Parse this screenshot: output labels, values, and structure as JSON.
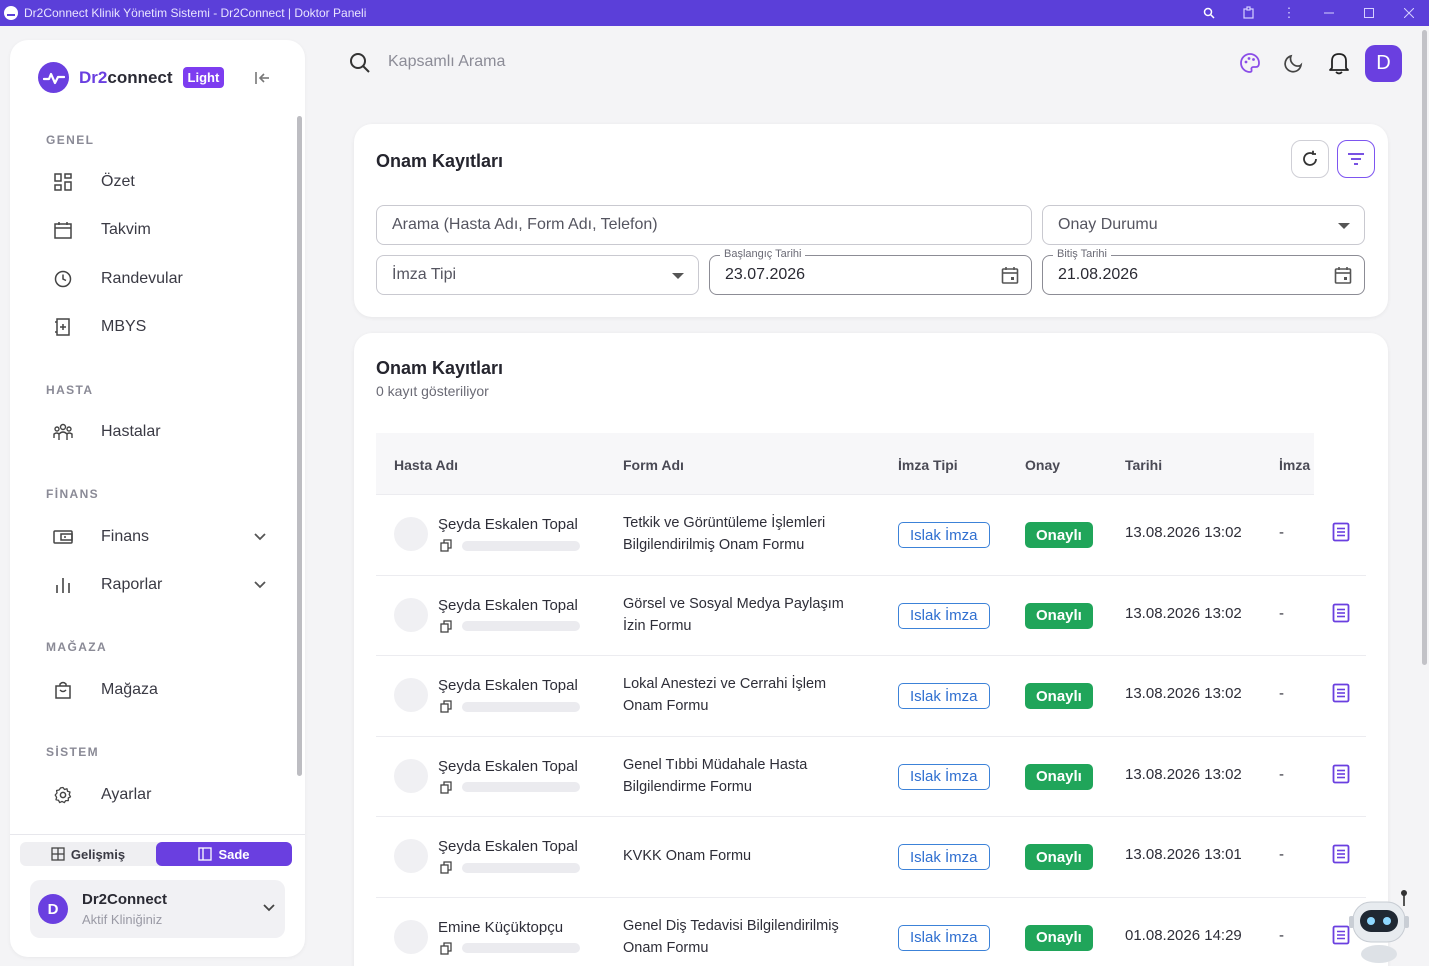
{
  "window": {
    "title": "Dr2Connect Klinik Yönetim Sistemi - Dr2Connect | Doktor Paneli"
  },
  "brand": {
    "name_a": "Dr2",
    "name_b": "connect",
    "badge": "Light"
  },
  "sidebar": {
    "sections": {
      "genel": "GENEL",
      "hasta": "HASTA",
      "finans": "FİNANS",
      "magaza": "MAĞAZA",
      "sistem": "SİSTEM"
    },
    "items": [
      {
        "label": "Özet",
        "icon": "dashboard-icon"
      },
      {
        "label": "Takvim",
        "icon": "calendar-icon"
      },
      {
        "label": "Randevular",
        "icon": "clock-icon"
      },
      {
        "label": "MBYS",
        "icon": "medical-book-icon"
      },
      {
        "label": "Hastalar",
        "icon": "patients-icon"
      },
      {
        "label": "Finans",
        "icon": "wallet-icon"
      },
      {
        "label": "Raporlar",
        "icon": "bar-chart-icon"
      },
      {
        "label": "Mağaza",
        "icon": "shopping-bag-icon"
      },
      {
        "label": "Ayarlar",
        "icon": "gear-icon"
      }
    ],
    "mode": {
      "advanced": "Gelişmiş",
      "simple": "Sade",
      "active": "simple"
    },
    "clinic": {
      "avatar": "D",
      "name": "Dr2Connect",
      "subtitle": "Aktif Kliniğiniz"
    }
  },
  "topbar": {
    "search_placeholder": "Kapsamlı Arama",
    "avatar": "D"
  },
  "filter_card": {
    "title": "Onam Kayıtları",
    "search_placeholder": "Arama (Hasta Adı, Form Adı, Telefon)",
    "approval_select": "Onay Durumu",
    "signature_select": "İmza Tipi",
    "start_label": "Başlangıç Tarihi",
    "start_value": "23.07.2026",
    "end_label": "Bitiş Tarihi",
    "end_value": "21.08.2026"
  },
  "list_card": {
    "title": "Onam Kayıtları",
    "subtitle": "0 kayıt gösteriliyor",
    "columns": [
      "Hasta Adı",
      "Form Adı",
      "İmza Tipi",
      "Onay",
      "Tarihi",
      "İmza"
    ],
    "rows": [
      {
        "patient": "Şeyda Eskalen Topal",
        "form_line1": "Tetkik ve Görüntüleme İşlemleri",
        "form_line2": "Bilgilendirilmiş Onam Formu",
        "signature": "Islak İmza",
        "approval": "Onaylı",
        "date": "13.08.2026 13:02",
        "sign": "-"
      },
      {
        "patient": "Şeyda Eskalen Topal",
        "form_line1": "Görsel ve Sosyal Medya Paylaşım",
        "form_line2": "İzin Formu",
        "signature": "Islak İmza",
        "approval": "Onaylı",
        "date": "13.08.2026 13:02",
        "sign": "-"
      },
      {
        "patient": "Şeyda Eskalen Topal",
        "form_line1": "Lokal Anestezi ve Cerrahi İşlem",
        "form_line2": "Onam Formu",
        "signature": "Islak İmza",
        "approval": "Onaylı",
        "date": "13.08.2026 13:02",
        "sign": "-"
      },
      {
        "patient": "Şeyda Eskalen Topal",
        "form_line1": "Genel Tıbbi Müdahale Hasta",
        "form_line2": "Bilgilendirme Formu",
        "signature": "Islak İmza",
        "approval": "Onaylı",
        "date": "13.08.2026 13:02",
        "sign": "-"
      },
      {
        "patient": "Şeyda Eskalen Topal",
        "form_line1": "KVKK Onam Formu",
        "form_line2": "",
        "signature": "Islak İmza",
        "approval": "Onaylı",
        "date": "13.08.2026 13:01",
        "sign": "-"
      },
      {
        "patient": "Emine Küçüktopçu",
        "form_line1": "Genel Diş Tedavisi Bilgilendirilmiş",
        "form_line2": "Onam Formu",
        "signature": "Islak İmza",
        "approval": "Onaylı",
        "date": "01.08.2026 14:29",
        "sign": "-"
      }
    ]
  },
  "colors": {
    "accent": "#6a3fe0",
    "titlebar": "#5b3fd9",
    "success": "#20a55a",
    "info": "#2f6fd0"
  }
}
